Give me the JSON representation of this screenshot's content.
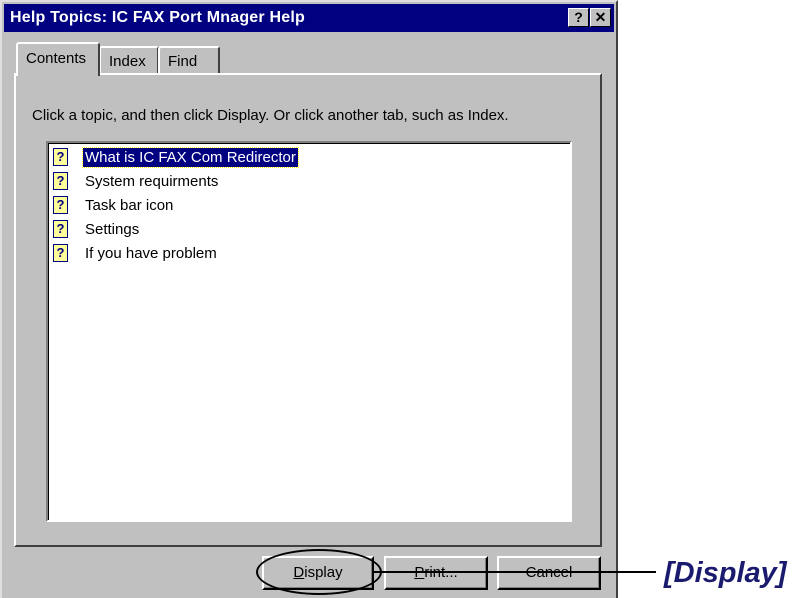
{
  "window": {
    "title": "Help Topics: IC FAX Port Mnager Help",
    "help_button": "?",
    "close_button": "✕"
  },
  "tabs": [
    {
      "label": "Contents",
      "active": true
    },
    {
      "label": "Index",
      "active": false
    },
    {
      "label": "Find",
      "active": false
    }
  ],
  "instruction": "Click a topic, and then click Display. Or click another tab, such as Index.",
  "topics": [
    {
      "label": "What is IC FAX Com Redirector",
      "icon": "help-book-icon",
      "selected": true
    },
    {
      "label": "System requirments",
      "icon": "help-book-icon",
      "selected": false
    },
    {
      "label": "Task bar icon",
      "icon": "help-book-icon",
      "selected": false
    },
    {
      "label": "Settings",
      "icon": "help-book-icon",
      "selected": false
    },
    {
      "label": "If you have problem",
      "icon": "help-book-icon",
      "selected": false
    }
  ],
  "buttons": {
    "display": {
      "accel": "D",
      "rest": "isplay"
    },
    "print": {
      "accel": "P",
      "rest": "rint..."
    },
    "cancel": "Cancel"
  },
  "callout": {
    "label": "[Display]",
    "color": "#1a1a6e"
  },
  "colors": {
    "titlebar": "#000080",
    "dialog_face": "#c0c0c0",
    "selection": "#000080"
  }
}
